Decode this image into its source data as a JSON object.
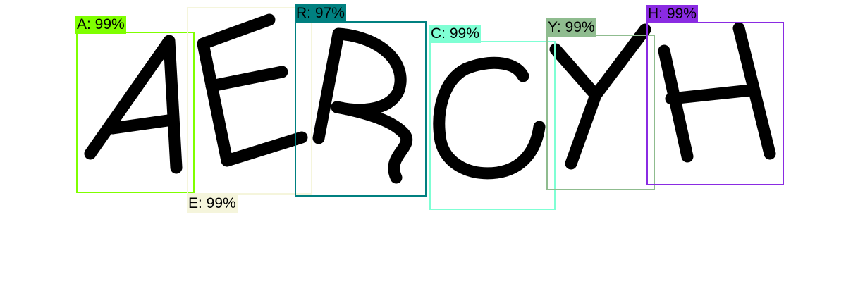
{
  "detections": [
    {
      "letter": "A",
      "label": "A: 99%",
      "color": "#7FFF00",
      "label_text_color": "#000000"
    },
    {
      "letter": "E",
      "label": "E: 99%",
      "color": "#F5F5DC",
      "label_text_color": "#000000"
    },
    {
      "letter": "R",
      "label": "R: 97%",
      "color": "#008080",
      "label_text_color": "#000000"
    },
    {
      "letter": "C",
      "label": "C: 99%",
      "color": "#7FFFD4",
      "label_text_color": "#000000"
    },
    {
      "letter": "Y",
      "label": "Y: 99%",
      "color": "#8FBC8F",
      "label_text_color": "#000000"
    },
    {
      "letter": "H",
      "label": "H: 99%",
      "color": "#8A2BE2",
      "label_text_color": "#000000"
    }
  ]
}
